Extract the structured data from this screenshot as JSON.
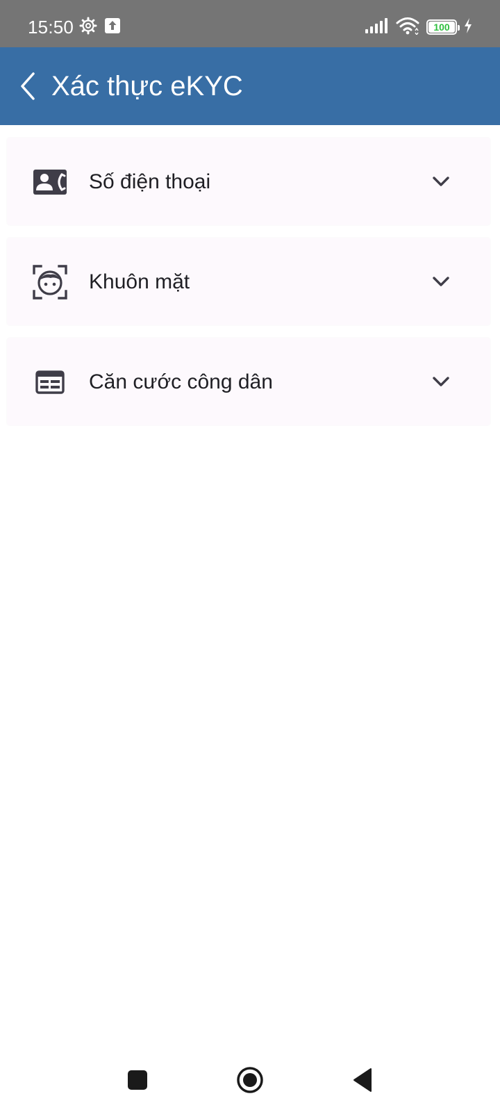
{
  "status_bar": {
    "time": "15:50",
    "battery_level": "100",
    "icons": [
      "settings-gear-icon",
      "upload-notification-icon",
      "signal-icon",
      "wifi-icon",
      "battery-icon",
      "charging-icon"
    ]
  },
  "app_bar": {
    "title": "Xác thực eKYC",
    "back_icon": "chevron-left-icon",
    "background": "#386ea5"
  },
  "sections": [
    {
      "label": "Số điện thoại",
      "icon": "contact-phone-icon",
      "expanded": false
    },
    {
      "label": "Khuôn mặt",
      "icon": "face-scan-icon",
      "expanded": false
    },
    {
      "label": "Căn cước công dân",
      "icon": "id-card-icon",
      "expanded": false
    }
  ],
  "nav_bar": {
    "buttons": [
      "recent-apps-icon",
      "home-icon",
      "back-icon"
    ]
  }
}
